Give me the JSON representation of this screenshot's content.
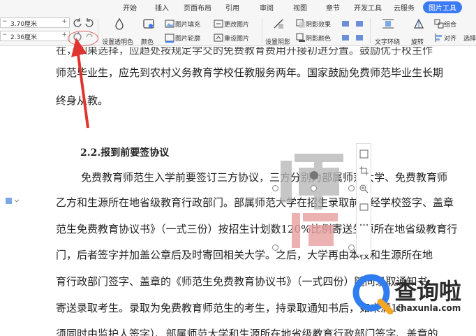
{
  "menu": {
    "tabs": [
      "开始",
      "插入",
      "页面布局",
      "引用",
      "审阅",
      "视图",
      "章节",
      "开发工具",
      "云服务",
      "图片工具"
    ],
    "active_tab": "图片工具"
  },
  "ribbon": {
    "height_value": "3.70厘米",
    "width_value": "2.36厘米",
    "set_transparency": "设置透明色",
    "color": "颜色",
    "picture_fill": "图片填充",
    "picture_outline": "图片轮廓",
    "change_picture": "更改图片",
    "reset_picture": "重设图片",
    "set_shadow": "设置阴影",
    "shadow_effect": "阴影效果",
    "shadow_color": "阴影颜色",
    "text_wrap": "文字环绕",
    "rotate": "旋转",
    "group": "组合",
    "align": "对齐",
    "select": "选择"
  },
  "document": {
    "line_top_partial": "在，如果选择，应趋处按规定学交的免费教育费用开接初进分置。鼓励优于校主作",
    "line1": "师范毕业生，应先到农村义务教育学校任教服务两年。国家鼓励免费师范毕业生长期",
    "line2": "终身从教。",
    "heading": "2.2.报到前要签协议",
    "para1": "免费教育师范生入学前要签订三方协议，三方分别为部属师范大学、免费教育师",
    "para2": "乙方和生源所在地省级教育行政部门。部属师范大学在招生录取前将经学校签字、盖章",
    "para3": "范生免费教育协议书》（一式三份）按招生计划数120%比例寄送生源所在地省级教育行",
    "para4": "门，后者签字并加盖公章后及时寄回相关大学。之后，大学再由本校和生源所在地",
    "para5": "育行政部门签字、盖章的《师范生免费教育协议书》（一式四份）随同录取通知书",
    "para6": "寄送录取考生。录取为免费教育师范生的考生，持录取通知书后，如未满18",
    "para7": "须同时由监护人签字）、部属师范大学和生源所在地省级教育行政部门签字、盖章的"
  },
  "watermark": {
    "logo_text": "查询啦",
    "logo_url_text": "chaxunla.com"
  }
}
